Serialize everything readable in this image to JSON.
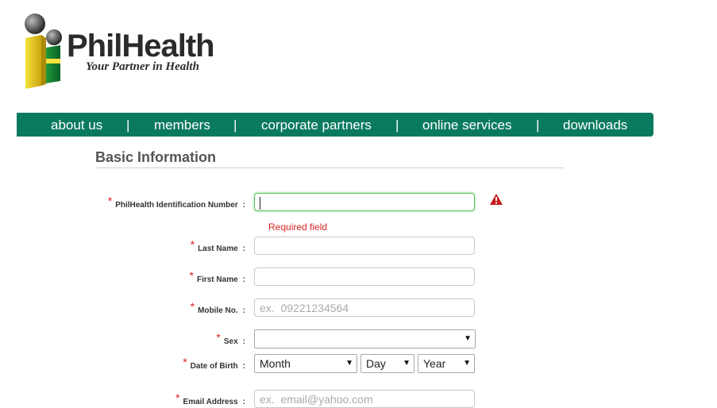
{
  "brand": {
    "name": "PhilHealth",
    "tagline": "Your Partner in Health"
  },
  "nav": {
    "items": [
      "about us",
      "members",
      "corporate partners",
      "online services",
      "downloads"
    ],
    "separator": "|"
  },
  "section": {
    "title": "Basic Information"
  },
  "form": {
    "required_mark": "*",
    "colon": ":",
    "pin": {
      "label": "PhilHealth Identification Number",
      "value": "",
      "error": "Required field"
    },
    "last_name": {
      "label": "Last Name",
      "value": ""
    },
    "first_name": {
      "label": "First Name",
      "value": ""
    },
    "mobile": {
      "label": "Mobile No.",
      "placeholder": "ex.  09221234564"
    },
    "sex": {
      "label": "Sex",
      "value": ""
    },
    "dob": {
      "label": "Date of Birth",
      "month": "Month",
      "day": "Day",
      "year": "Year"
    },
    "email": {
      "label": "Email Address",
      "placeholder": "ex.  email@yahoo.com"
    }
  },
  "colors": {
    "nav_bg": "#0a7a5e",
    "error": "#dd2222",
    "focus_border": "#56c456"
  }
}
